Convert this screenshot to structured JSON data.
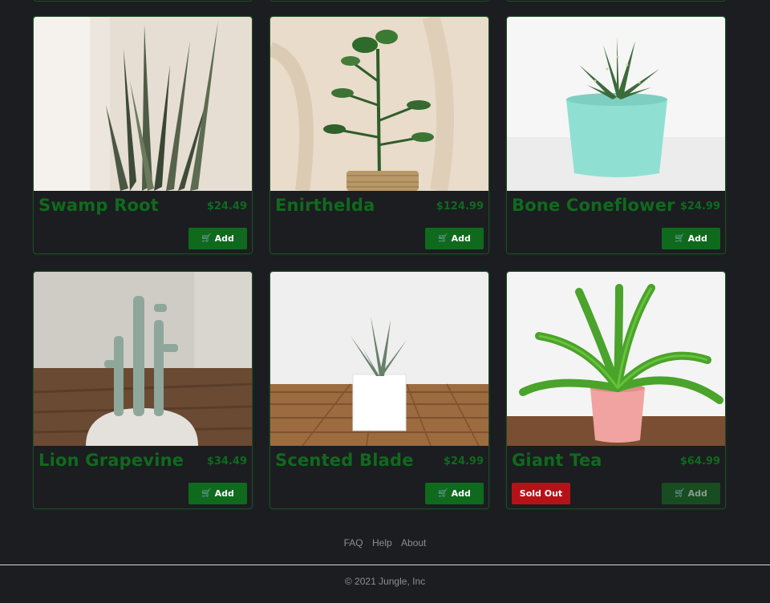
{
  "products": [
    {
      "name": "Swamp Root",
      "price": "$24.49",
      "add_label": "Add",
      "sold_out": false,
      "image_icon": "snake-plant-photo"
    },
    {
      "name": "Enirthelda",
      "price": "$124.99",
      "add_label": "Add",
      "sold_out": false,
      "image_icon": "jade-plant-photo"
    },
    {
      "name": "Bone Coneflower",
      "price": "$24.99",
      "add_label": "Add",
      "sold_out": false,
      "image_icon": "haworthia-photo"
    },
    {
      "name": "Lion Grapevine",
      "price": "$34.49",
      "add_label": "Add",
      "sold_out": false,
      "image_icon": "cactus-photo"
    },
    {
      "name": "Scented Blade",
      "price": "$24.99",
      "add_label": "Add",
      "sold_out": false,
      "image_icon": "succulent-photo"
    },
    {
      "name": "Giant Tea",
      "price": "$64.99",
      "add_label": "Add",
      "sold_out": true,
      "sold_out_label": "Sold Out",
      "image_icon": "fern-photo"
    }
  ],
  "footer": {
    "links": [
      "FAQ",
      "Help",
      "About"
    ],
    "copyright": "© 2021 Jungle, Inc"
  },
  "colors": {
    "background": "#1b1d20",
    "accent": "#0f6a1d",
    "sold_out": "#b51218",
    "muted_text": "#8c8f93"
  },
  "cart_icon": "shopping-cart-icon"
}
